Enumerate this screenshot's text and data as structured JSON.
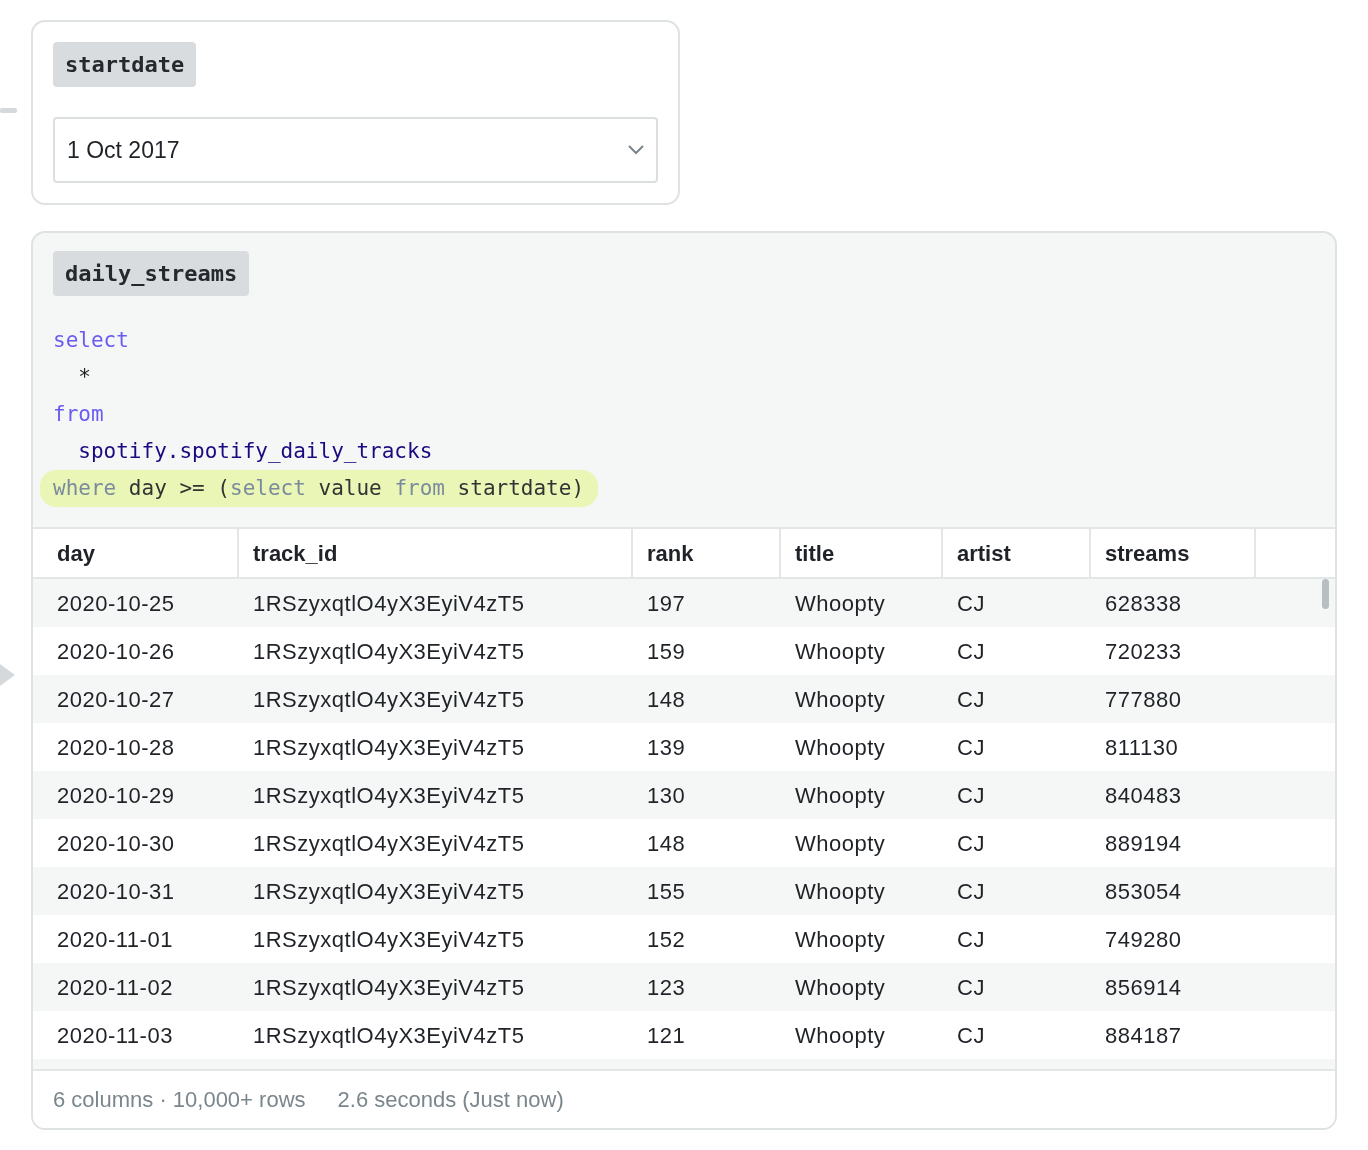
{
  "input_cell": {
    "name": "startdate",
    "value": "1 Oct 2017"
  },
  "query_cell": {
    "name": "daily_streams",
    "code_lines": [
      {
        "highlighted": false,
        "tokens": [
          {
            "kind": "keyword",
            "text": "select"
          }
        ]
      },
      {
        "highlighted": false,
        "tokens": [
          {
            "kind": "plain",
            "text": "  *"
          }
        ]
      },
      {
        "highlighted": false,
        "tokens": [
          {
            "kind": "keyword",
            "text": "from"
          }
        ]
      },
      {
        "highlighted": false,
        "tokens": [
          {
            "kind": "table",
            "text": "  spotify.spotify_daily_tracks"
          }
        ]
      },
      {
        "highlighted": true,
        "tokens": [
          {
            "kind": "keyword",
            "text": "where"
          },
          {
            "kind": "plain",
            "text": " day >= ("
          },
          {
            "kind": "keyword",
            "text": "select"
          },
          {
            "kind": "plain",
            "text": " value "
          },
          {
            "kind": "keyword",
            "text": "from"
          },
          {
            "kind": "plain",
            "text": " startdate)"
          }
        ]
      }
    ],
    "table": {
      "columns": [
        "day",
        "track_id",
        "rank",
        "title",
        "artist",
        "streams"
      ],
      "rows": [
        [
          "2020-10-25",
          "1RSzyxqtlO4yX3EyiV4zT5",
          "197",
          "Whoopty",
          "CJ",
          "628338"
        ],
        [
          "2020-10-26",
          "1RSzyxqtlO4yX3EyiV4zT5",
          "159",
          "Whoopty",
          "CJ",
          "720233"
        ],
        [
          "2020-10-27",
          "1RSzyxqtlO4yX3EyiV4zT5",
          "148",
          "Whoopty",
          "CJ",
          "777880"
        ],
        [
          "2020-10-28",
          "1RSzyxqtlO4yX3EyiV4zT5",
          "139",
          "Whoopty",
          "CJ",
          "811130"
        ],
        [
          "2020-10-29",
          "1RSzyxqtlO4yX3EyiV4zT5",
          "130",
          "Whoopty",
          "CJ",
          "840483"
        ],
        [
          "2020-10-30",
          "1RSzyxqtlO4yX3EyiV4zT5",
          "148",
          "Whoopty",
          "CJ",
          "889194"
        ],
        [
          "2020-10-31",
          "1RSzyxqtlO4yX3EyiV4zT5",
          "155",
          "Whoopty",
          "CJ",
          "853054"
        ],
        [
          "2020-11-01",
          "1RSzyxqtlO4yX3EyiV4zT5",
          "152",
          "Whoopty",
          "CJ",
          "749280"
        ],
        [
          "2020-11-02",
          "1RSzyxqtlO4yX3EyiV4zT5",
          "123",
          "Whoopty",
          "CJ",
          "856914"
        ],
        [
          "2020-11-03",
          "1RSzyxqtlO4yX3EyiV4zT5",
          "121",
          "Whoopty",
          "CJ",
          "884187"
        ]
      ]
    },
    "status": {
      "shape": "6 columns · 10,000+ rows",
      "timing": "2.6 seconds (Just now)"
    }
  }
}
